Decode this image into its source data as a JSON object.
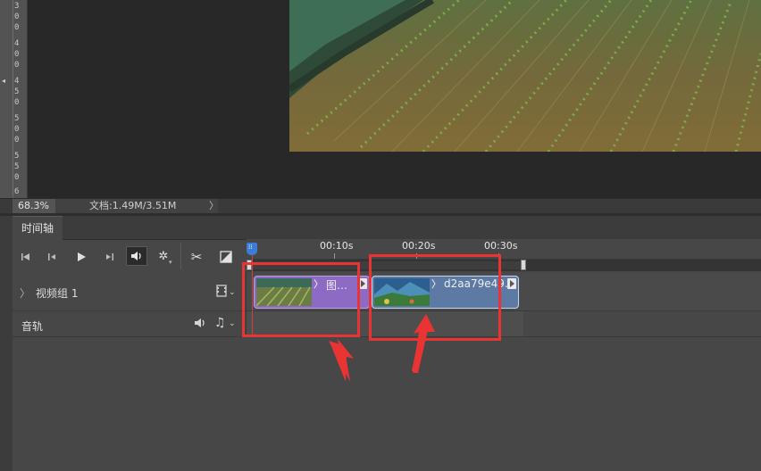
{
  "ruler": {
    "digits": [
      "3",
      "0",
      "0",
      "4",
      "0",
      "0",
      "4",
      "5",
      "0",
      "5",
      "0",
      "0",
      "5",
      "5",
      "0",
      "6"
    ]
  },
  "status": {
    "zoom": "68.3%",
    "doc_info": "文档:1.49M/3.51M",
    "arrow": "〉"
  },
  "panel": {
    "tab_label": "时间轴"
  },
  "transport": {
    "icons": [
      "skip-to-start-icon",
      "step-back-icon",
      "play-icon",
      "step-forward-icon",
      "audio-speaker-icon",
      "settings-gear-icon",
      "scissors-icon",
      "transition-icon"
    ]
  },
  "time_ruler": {
    "labels": [
      "00:10s",
      "00:20s",
      "00:30s"
    ]
  },
  "tracks": {
    "video": {
      "chevron": "〉",
      "label": "视频组 1"
    },
    "audio": {
      "label": "音轨"
    }
  },
  "clips": [
    {
      "title": "图…",
      "chevron": "〉"
    },
    {
      "title": "d2aa79e49…",
      "chevron": "〉"
    }
  ],
  "colors": {
    "clip1": "#8d6bc4",
    "clip2": "#5c7aa4",
    "annotation": "#ea3434",
    "playhead": "#3d7cd6"
  }
}
